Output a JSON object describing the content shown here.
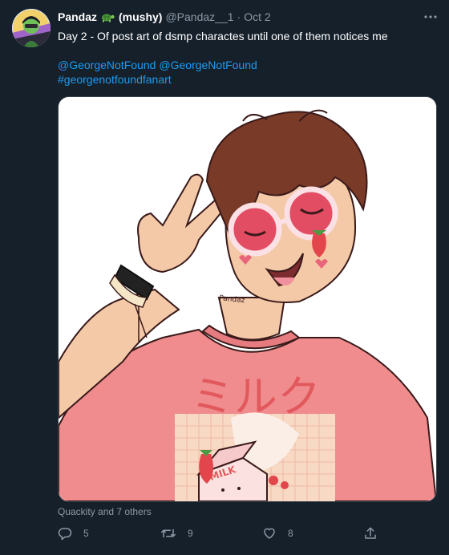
{
  "tweet": {
    "author_name": "Pandaz",
    "author_suffix": "(mushy)",
    "handle": "@Pandaz__1",
    "separator": "·",
    "date": "Oct 2",
    "text": "Day 2 - Of post art of dsmp charactes until one of them notices me",
    "mentions": [
      "@GeorgeNotFound",
      "@GeorgeNotFound"
    ],
    "hashtag": "#georgenotfoundfanart",
    "media_signature": "Pandaz",
    "media_jp_text": "ミルク",
    "media_carton_text": "MILK",
    "liked_by": "Quackity and 7 others"
  },
  "actions": {
    "reply_count": "5",
    "retweet_count": "9",
    "like_count": "8"
  },
  "colors": {
    "background": "#15202b",
    "link": "#1d9bf0",
    "muted": "#8b98a5",
    "border": "#38444d"
  },
  "icons": [
    "turtle-emoji-icon",
    "more-options-icon",
    "reply-icon",
    "retweet-icon",
    "like-icon",
    "share-icon"
  ]
}
